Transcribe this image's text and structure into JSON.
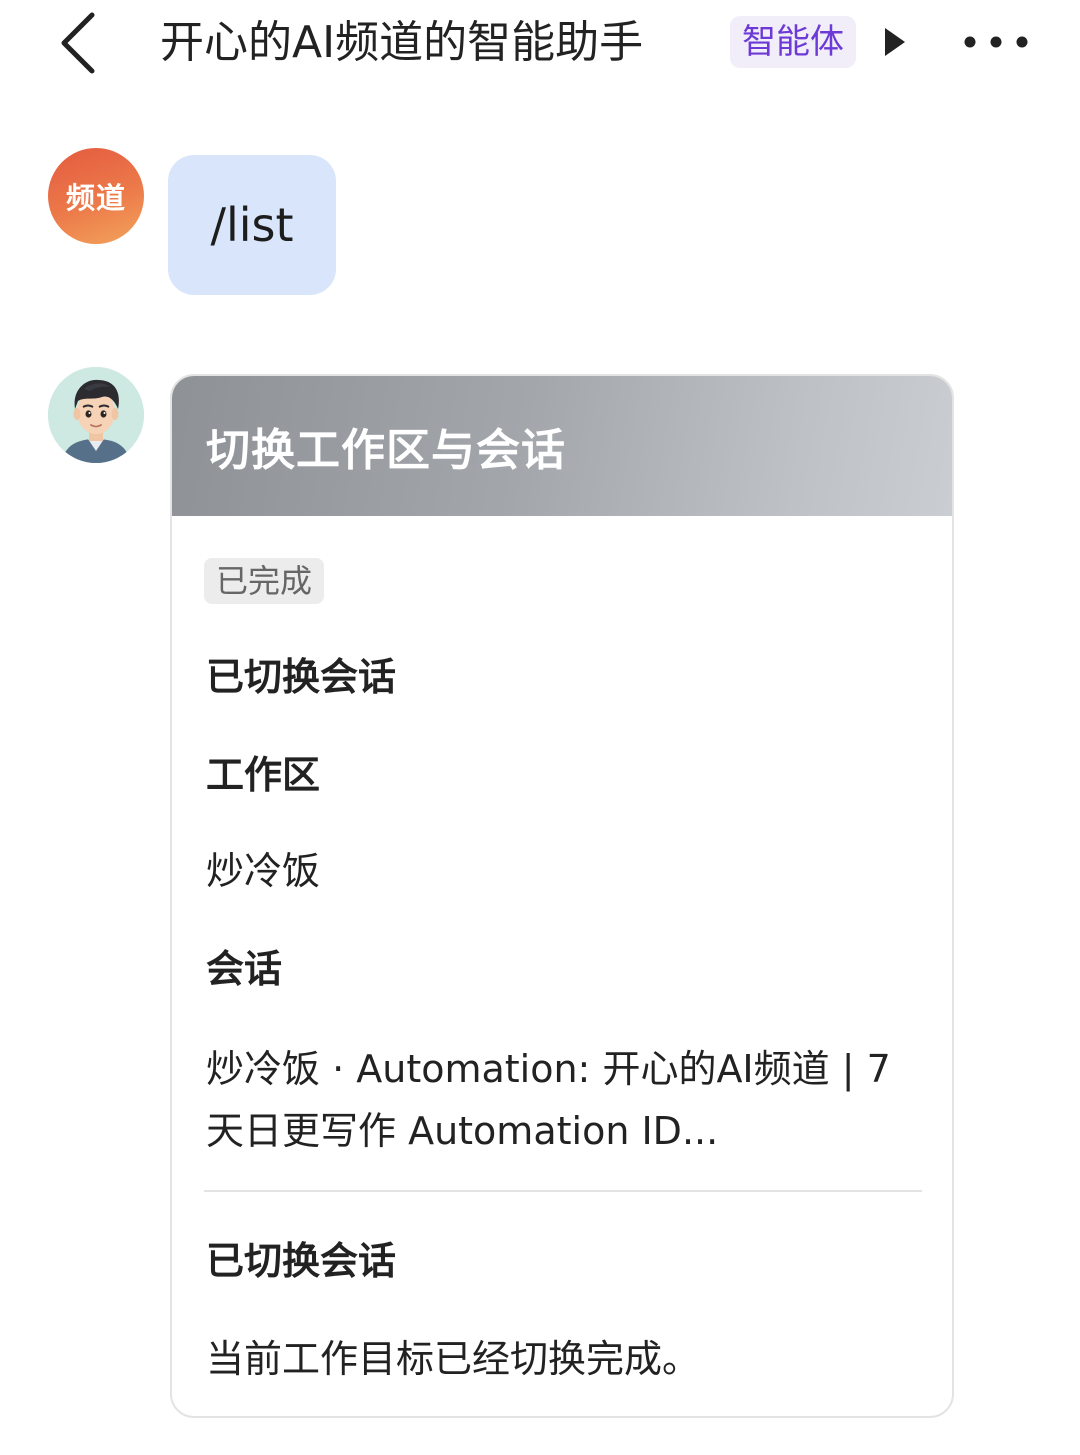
{
  "header": {
    "title": "开心的AI频道的智能助手",
    "badge": "智能体",
    "back_icon": "chevron-left-icon",
    "expand_icon": "play-triangle-icon",
    "more_icon": "more-horizontal-icon"
  },
  "messages": {
    "user": {
      "avatar_text": "频道",
      "text": "/list"
    },
    "bot": {
      "avatar_icon": "cartoon-man-avatar-icon",
      "card": {
        "title": "切换工作区与会话",
        "status": "已完成",
        "section1_heading": "已切换会话",
        "workspace_label": "工作区",
        "workspace_value": "炒冷饭",
        "session_label": "会话",
        "session_value": "炒冷饭 · Automation: 开心的AI频道 | 7 天日更写作 Automation ID...",
        "section2_heading": "已切换会话",
        "section2_text": "当前工作目标已经切换完成。"
      }
    }
  },
  "colors": {
    "badge_text": "#6e3ad6",
    "badge_bg": "#f1eefa",
    "user_bubble": "#d8e5fb",
    "channel_avatar": "#ec7a4a",
    "card_header": "#a3a7ac"
  }
}
